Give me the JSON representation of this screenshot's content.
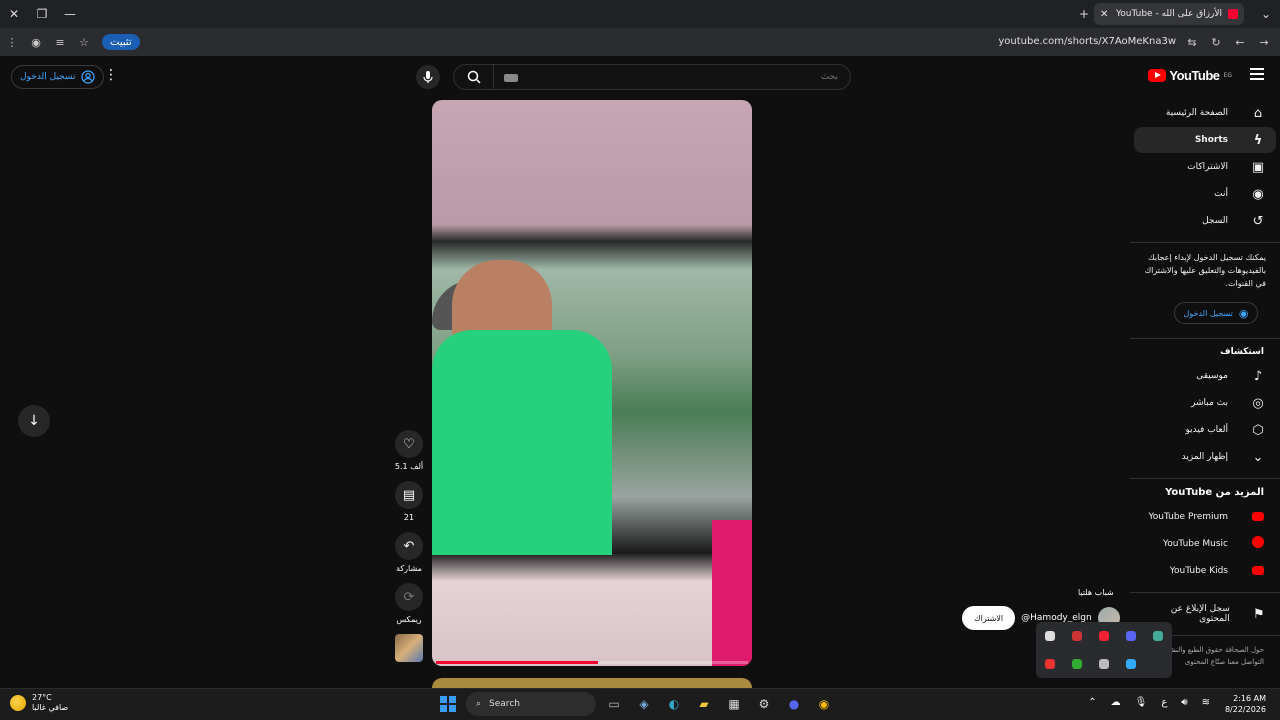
{
  "browser": {
    "tab_title": "الأرزاق على الله - YouTube",
    "pin_label": "تثبيت",
    "url": "youtube.com/shorts/X7AoMeKna3w"
  },
  "header": {
    "signin_label": "تسجيل الدخول",
    "search_placeholder": "بحث",
    "logo_text": "YouTube",
    "region": "EG"
  },
  "sidebar": {
    "items": [
      {
        "label": "الصفحة الرئيسية",
        "icon": "home-icon"
      },
      {
        "label": "Shorts",
        "icon": "shorts-icon"
      },
      {
        "label": "الاشتراكات",
        "icon": "subscriptions-icon"
      },
      {
        "label": "أنت",
        "icon": "you-icon"
      },
      {
        "label": "السجل",
        "icon": "history-icon"
      }
    ],
    "signin_note": "يمكنك تسجيل الدخول لإبداء إعجابك بالفيديوهات والتعليق عليها والاشتراك في القنوات.",
    "signin_label": "تسجيل الدخول",
    "explore_title": "استكشاف",
    "explore": [
      {
        "label": "موسيقى",
        "icon": "music-icon"
      },
      {
        "label": "بث مباشر",
        "icon": "live-icon"
      },
      {
        "label": "ألعاب فيديو",
        "icon": "gaming-icon"
      },
      {
        "label": "إظهار المزيد",
        "icon": "chevron-down-icon"
      }
    ],
    "more_title": "المزيد من YouTube",
    "more": [
      {
        "label": "YouTube Premium"
      },
      {
        "label": "YouTube Music"
      },
      {
        "label": "YouTube Kids"
      }
    ],
    "report_label": "سجل الإبلاغ عن المحتوى",
    "footer": "حول الصحافة حقوق الطبع والنشر التواصل معنا صنّاع المحتوى"
  },
  "shorts": {
    "likes": "5.1 ألف",
    "comments": "21",
    "share": "مشاركة",
    "remix": "ريمكس",
    "channel": "@Hamody_elgn",
    "subscribe": "الاشتراك",
    "channel_tag": "شباب هلتيا"
  },
  "taskbar": {
    "temp": "27°C",
    "weather": "صافي غالبا",
    "search": "Search",
    "time": "2:16 AM",
    "date": "8/22/2026"
  }
}
